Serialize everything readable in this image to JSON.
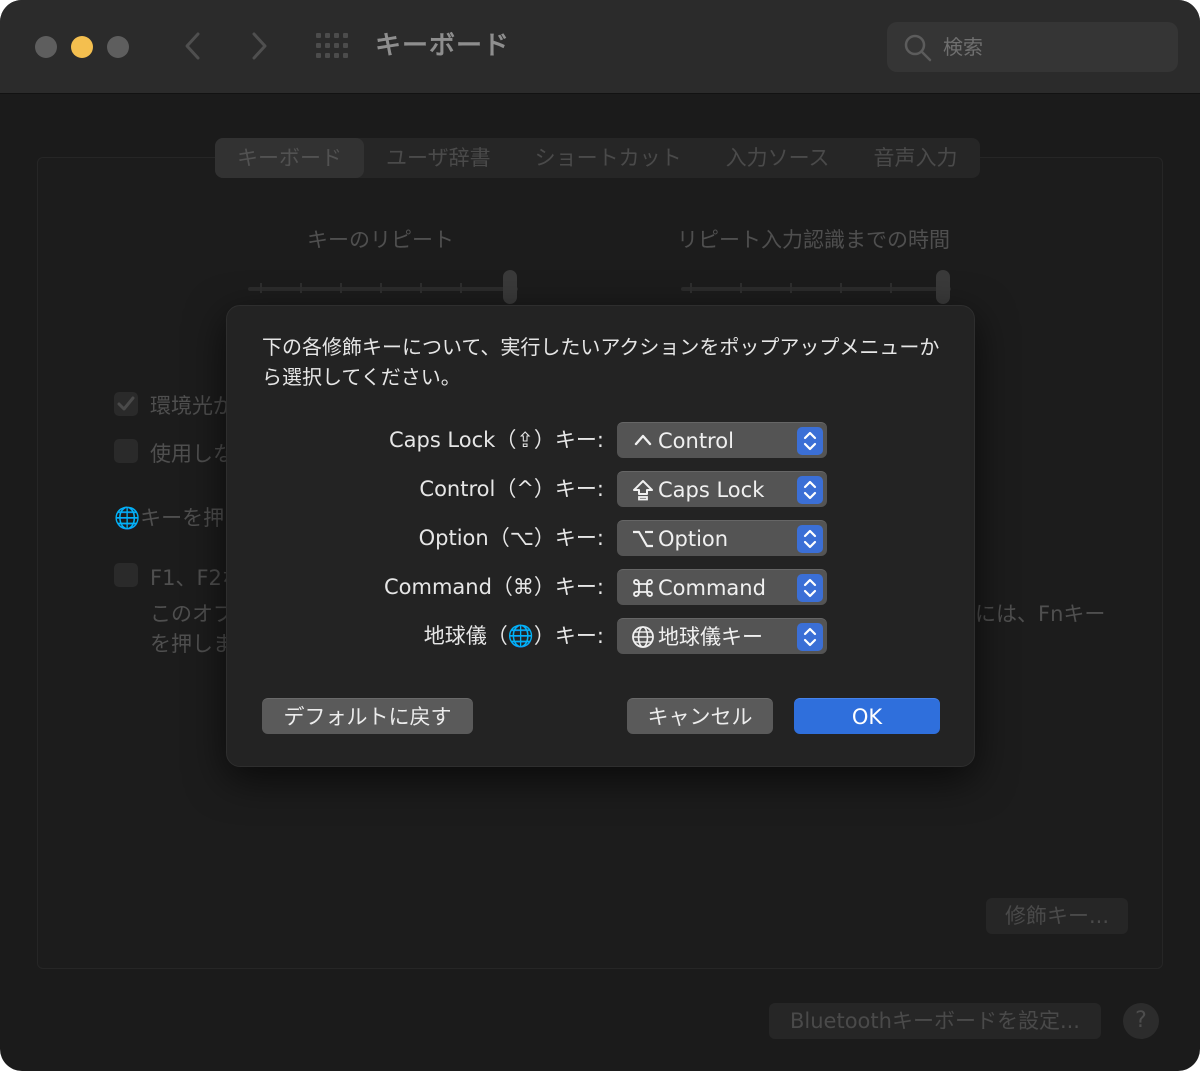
{
  "window": {
    "title": "キーボード",
    "search_placeholder": "検索"
  },
  "tabs": [
    {
      "label": "キーボード",
      "active": true
    },
    {
      "label": "ユーザ辞書",
      "active": false
    },
    {
      "label": "ショートカット",
      "active": false
    },
    {
      "label": "入力ソース",
      "active": false
    },
    {
      "label": "音声入力",
      "active": false
    }
  ],
  "background": {
    "key_repeat_label": "キーのリピート",
    "delay_label": "リピート入力認識までの時間",
    "ambient_label": "環境光が",
    "unused_label": "使用しな",
    "globe_key_label": "🌐キーを押",
    "fkeys_label": "F1、F2な",
    "fkeys_desc_1": "このオプ",
    "fkeys_desc_2": "を押しま",
    "fkeys_desc_right": "には、Fnキー",
    "modifier_button": "修飾キー...",
    "bluetooth_button": "Bluetoothキーボードを設定...",
    "help": "?"
  },
  "sheet": {
    "description": "下の各修飾キーについて、実行したいアクションをポップアップメニューから選択してください。",
    "rows": [
      {
        "label": "Caps Lock（⇪）キー:",
        "value": "Control",
        "symbol": "caret"
      },
      {
        "label": "Control（^）キー:",
        "value": "Caps Lock",
        "symbol": "capslock"
      },
      {
        "label": "Option（⌥）キー:",
        "value": "Option",
        "symbol": "option"
      },
      {
        "label": "Command（⌘）キー:",
        "value": "Command",
        "symbol": "command"
      },
      {
        "label": "地球儀（🌐）キー:",
        "value": "地球儀キー",
        "symbol": "globe"
      }
    ],
    "restore_defaults": "デフォルトに戻す",
    "cancel": "キャンセル",
    "ok": "OK"
  },
  "colors": {
    "accent": "#2f6fdc",
    "yellow_light": "#f4bf4f"
  }
}
